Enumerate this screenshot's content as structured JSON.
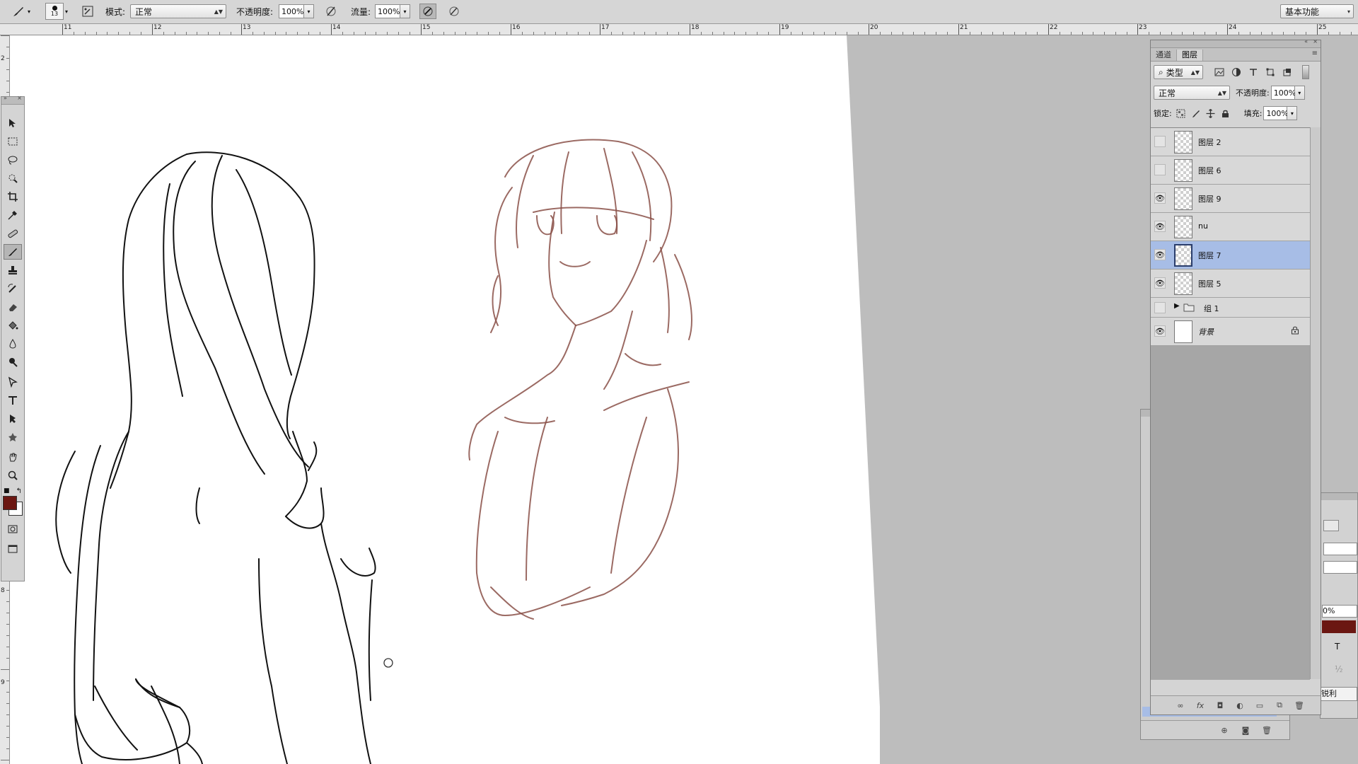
{
  "options_bar": {
    "brush_size": "13",
    "mode_label": "模式:",
    "mode_value": "正常",
    "opacity_label": "不透明度:",
    "opacity_value": "100%",
    "flow_label": "流量:",
    "flow_value": "100%",
    "workspace": "基本功能"
  },
  "ruler": {
    "numbers": [
      "11",
      "12",
      "13",
      "14",
      "15",
      "16",
      "17",
      "18",
      "19",
      "20",
      "21",
      "22",
      "23",
      "24",
      "25"
    ],
    "v_numbers": [
      "2",
      "8",
      "9"
    ]
  },
  "colors": {
    "foreground": "#6b1712",
    "background": "#ffffff",
    "selected_layer": "#a7bde6",
    "sketch_stroke": "#8a5048"
  },
  "layers_panel": {
    "tabs": [
      "通道",
      "图层"
    ],
    "active_tab": "图层",
    "filter_label": "类型",
    "blend_mode": "正常",
    "opacity_label": "不透明度:",
    "opacity_value": "100%",
    "lock_label": "锁定:",
    "fill_label": "填充:",
    "fill_value": "100%",
    "layers": [
      {
        "name": "图层 2",
        "visible": false,
        "selected": false
      },
      {
        "name": "图层 6",
        "visible": false,
        "selected": false
      },
      {
        "name": "图层 9",
        "visible": true,
        "selected": false
      },
      {
        "name": "nu",
        "visible": true,
        "selected": false
      },
      {
        "name": "图层 7",
        "visible": true,
        "selected": true
      },
      {
        "name": "图层 5",
        "visible": true,
        "selected": false
      }
    ],
    "group": {
      "name": "组 1",
      "visible": false
    },
    "background_layer": {
      "name": "背景",
      "visible": true,
      "locked": true
    }
  },
  "side_panel": {
    "percent_value": "0%",
    "dropdown_value": "锐利"
  }
}
